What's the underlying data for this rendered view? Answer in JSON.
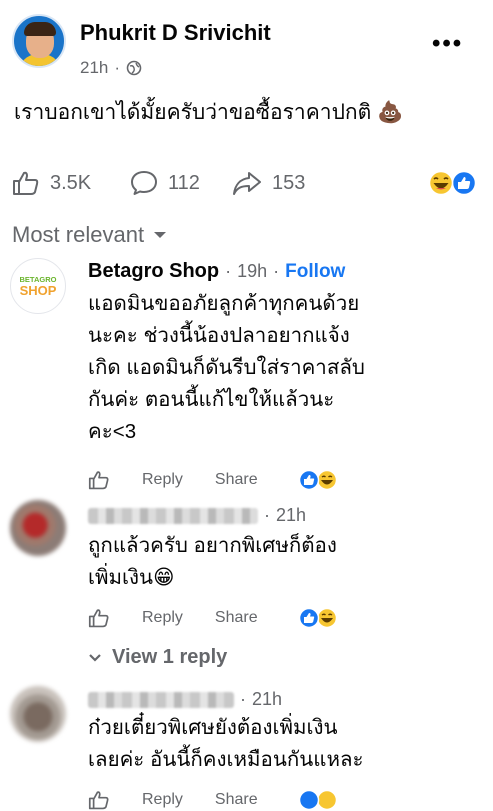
{
  "post": {
    "author": "Phukrit D Srivichit",
    "time": "21h",
    "time_sep": "·",
    "text": "เราบอกเขาได้มั้ยครับว่าขอซื้อราคาปกติ",
    "text_emoji": "💩",
    "likes": "3.5K",
    "comments": "112",
    "shares": "153"
  },
  "sort": {
    "label": "Most relevant"
  },
  "comments": [
    {
      "author": "Betagro Shop",
      "time": "19h",
      "sep": "·",
      "follow": "Follow",
      "avatar_text": "BETAGRO SHOP",
      "lines": [
        "แอดมินขออภัยลูกค้าทุกคนด้วย",
        "นะคะ ช่วงนี้น้องปลาอยากแจ้ง",
        "เกิด แอดมินก็ดันรีบใส่ราคาสลับ",
        "กันค่ะ ตอนนี้แก้ไขให้แล้วนะ",
        "คะ<3"
      ],
      "reply": "Reply",
      "share": "Share"
    },
    {
      "time": "21h",
      "sep": "·",
      "lines": [
        "ถูกแล้วครับ อยากพิเศษก็ต้อง",
        "เพิ่มเงิน😁"
      ],
      "reply": "Reply",
      "share": "Share",
      "view_replies": "View 1 reply"
    },
    {
      "time": "21h",
      "sep": "·",
      "lines": [
        "ก๋วยเตี๋ยวพิเศษยังต้องเพิ่มเงิน",
        "เลยค่ะ อันนี้ก็คงเหมือนกันแหละ"
      ],
      "reply": "Reply",
      "share": "Share"
    }
  ],
  "colors": {
    "accent": "#1877f2",
    "muted": "#65676b",
    "brand_green": "#6bb52e",
    "brand_orange": "#f0a22e"
  }
}
